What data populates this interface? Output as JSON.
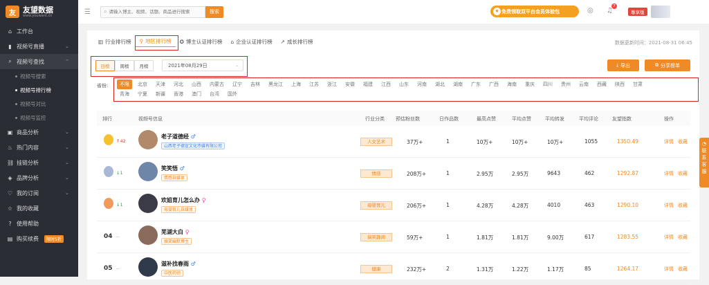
{
  "brand": {
    "name": "友望数据",
    "sub": "www.youwant.cn"
  },
  "sidebar": {
    "items": [
      {
        "label": "工作台",
        "icon": "home-icon"
      },
      {
        "label": "视频号直播",
        "icon": "chart-icon"
      },
      {
        "label": "视频号查找",
        "icon": "search-icon"
      },
      {
        "label": "商品分析",
        "icon": "bag-icon"
      },
      {
        "label": "热门内容",
        "icon": "fire-icon"
      },
      {
        "label": "挂链分析",
        "icon": "link-icon"
      },
      {
        "label": "品牌分析",
        "icon": "tag-icon"
      },
      {
        "label": "我的订阅",
        "icon": "heart-icon"
      },
      {
        "label": "我的收藏",
        "icon": "star-icon"
      },
      {
        "label": "使用帮助",
        "icon": "help-icon"
      },
      {
        "label": "购买续费",
        "icon": "cart-icon",
        "badge": "限时5折"
      }
    ],
    "subitems": [
      "视频号搜索",
      "视频号排行榜",
      "视频号对比",
      "视频号监控"
    ]
  },
  "topbar": {
    "search_placeholder": "请输入博主、视频、话题、商品进行搜索",
    "search_button": "搜索",
    "promo": "免费领取双平台会员体验包",
    "notif_count": "7",
    "vip": "尊享版"
  },
  "tabs": [
    {
      "label": "行业排行榜",
      "icon": "bars-icon"
    },
    {
      "label": "地区排行榜",
      "icon": "pin-icon"
    },
    {
      "label": "博主认证排行榜",
      "icon": "badge-icon"
    },
    {
      "label": "企业认证排行榜",
      "icon": "building-icon"
    },
    {
      "label": "成长排行榜",
      "icon": "growth-icon"
    }
  ],
  "update_time": "数据更新时间：2021-08-31 06:45",
  "period": {
    "options": [
      "日榜",
      "周榜",
      "月榜"
    ],
    "active": "日榜",
    "date": "2021年08月29日"
  },
  "actions": {
    "export": "导出",
    "share": "分享榜单"
  },
  "province_label": "省份:",
  "provinces": [
    "不限",
    "北京",
    "天津",
    "河北",
    "山西",
    "内蒙古",
    "辽宁",
    "吉林",
    "黑龙江",
    "上海",
    "江苏",
    "浙江",
    "安徽",
    "福建",
    "江西",
    "山东",
    "河南",
    "湖北",
    "湖南",
    "广东",
    "广西",
    "海南",
    "重庆",
    "四川",
    "贵州",
    "云南",
    "西藏",
    "陕西",
    "甘肃",
    "青海",
    "宁夏",
    "新疆",
    "香港",
    "澳门",
    "台湾",
    "国外"
  ],
  "table": {
    "headers": [
      "排行",
      "视频号信息",
      "行业分类",
      "预估粉丝数",
      "日作品数",
      "最高点赞",
      "平均点赞",
      "平均转发",
      "平均评论",
      "友望指数",
      "操作"
    ],
    "rows": [
      {
        "rank": "01",
        "trend": "↑42",
        "name": "老子道德经",
        "gender": "male",
        "tag": "山西老子德宣文化传媒有限公司",
        "tag_blue": true,
        "category": "人文艺术",
        "fans": "37万+",
        "daily": "1",
        "max_like": "10万+",
        "avg_like": "10万+",
        "avg_share": "10万+",
        "avg_comment": "1055",
        "index": "1350.49"
      },
      {
        "rank": "02",
        "trend": "↓1",
        "name": "笑笑悟",
        "gender": "male",
        "tag": "情感自媒体",
        "tag_blue": false,
        "category": "情感",
        "fans": "208万+",
        "daily": "1",
        "max_like": "2.95万",
        "avg_like": "2.95万",
        "avg_share": "9643",
        "avg_comment": "462",
        "index": "1292.87"
      },
      {
        "rank": "03",
        "trend": "↓1",
        "name": "欢姐育儿怎么办",
        "gender": "female",
        "tag": "母婴育儿自媒体",
        "tag_blue": false,
        "category": "母婴育儿",
        "fans": "206万+",
        "daily": "1",
        "max_like": "4.28万",
        "avg_like": "4.28万",
        "avg_share": "4010",
        "avg_comment": "463",
        "index": "1290.10"
      },
      {
        "rank": "04",
        "trend": "--",
        "name": "芜湖大白",
        "gender": "female",
        "tag": "搞笑幽默博主",
        "tag_blue": false,
        "category": "搞笑趣闻",
        "fans": "59万+",
        "daily": "1",
        "max_like": "1.81万",
        "avg_like": "1.81万",
        "avg_share": "9.00万",
        "avg_comment": "617",
        "index": "1283.55"
      },
      {
        "rank": "05",
        "trend": "--",
        "name": "滋补找春雨",
        "gender": "male",
        "tag": "中医药师",
        "tag_blue": false,
        "category": "健康",
        "fans": "232万+",
        "daily": "2",
        "max_like": "1.31万",
        "avg_like": "1.22万",
        "avg_share": "1.17万",
        "avg_comment": "85",
        "index": "1264.17"
      }
    ],
    "actions": [
      "详情",
      "收藏"
    ]
  },
  "side_float": "联系客服"
}
